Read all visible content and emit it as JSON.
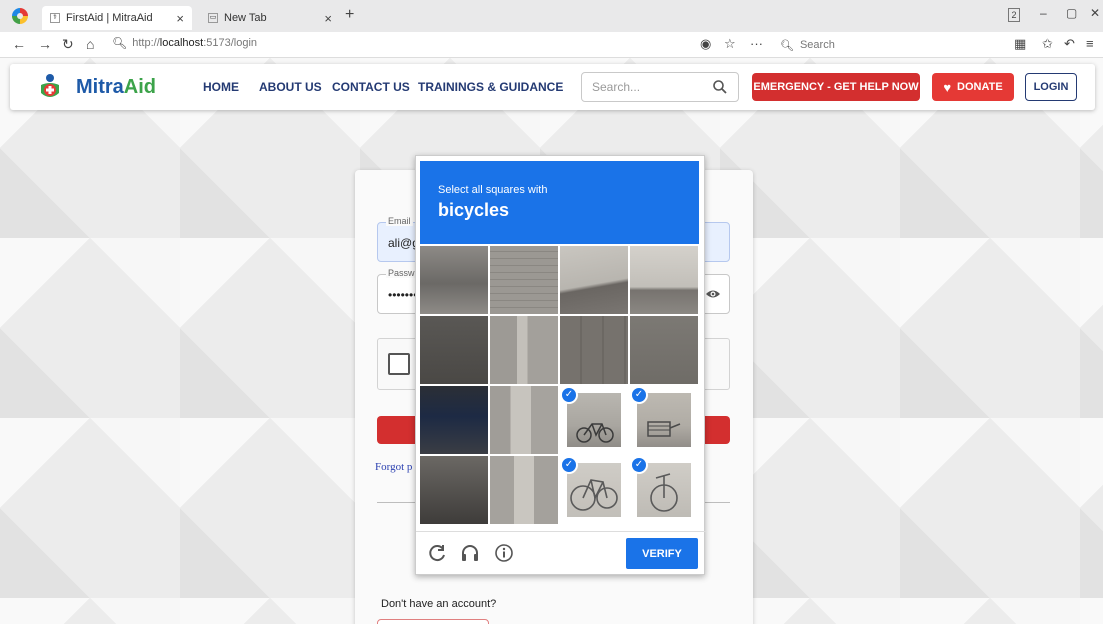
{
  "browser": {
    "tabs": [
      {
        "title": "FirstAid | MitraAid",
        "close": "×"
      },
      {
        "title": "New Tab",
        "close": "×"
      }
    ],
    "new_tab": "+",
    "window_count": "2",
    "address": {
      "proto": "http://",
      "host": "localhost",
      "path": ":5173/login"
    },
    "search_placeholder": "Search"
  },
  "navbar": {
    "brand_part1": "Mitra",
    "brand_part2": "Aid",
    "links": [
      "HOME",
      "ABOUT US",
      "CONTACT US",
      "TRAININGS & GUIDANCE"
    ],
    "search_placeholder": "Search...",
    "emergency_label": "EMERGENCY - GET HELP NOW",
    "donate_label": "DONATE",
    "login_label": "LOGIN",
    "colors": {
      "primary_navy": "#243a73",
      "brand_blue": "#1e5aa8",
      "brand_green": "#3ca34a",
      "emergency_red": "#d32f2f"
    }
  },
  "login_form": {
    "email_label": "Email",
    "email_value": "ali@g",
    "password_label": "Passw",
    "password_value": "••••••••",
    "forgot_text": "Forgot p",
    "no_account_text": "Don't have an account?"
  },
  "captcha": {
    "instruction": "Select all squares with",
    "target": "bicycles",
    "verify_label": "VERIFY",
    "selected_tiles": [
      10,
      11,
      14,
      15
    ],
    "icons": [
      "reload-icon",
      "audio-icon",
      "info-icon"
    ],
    "accent_color": "#1a73e8"
  }
}
